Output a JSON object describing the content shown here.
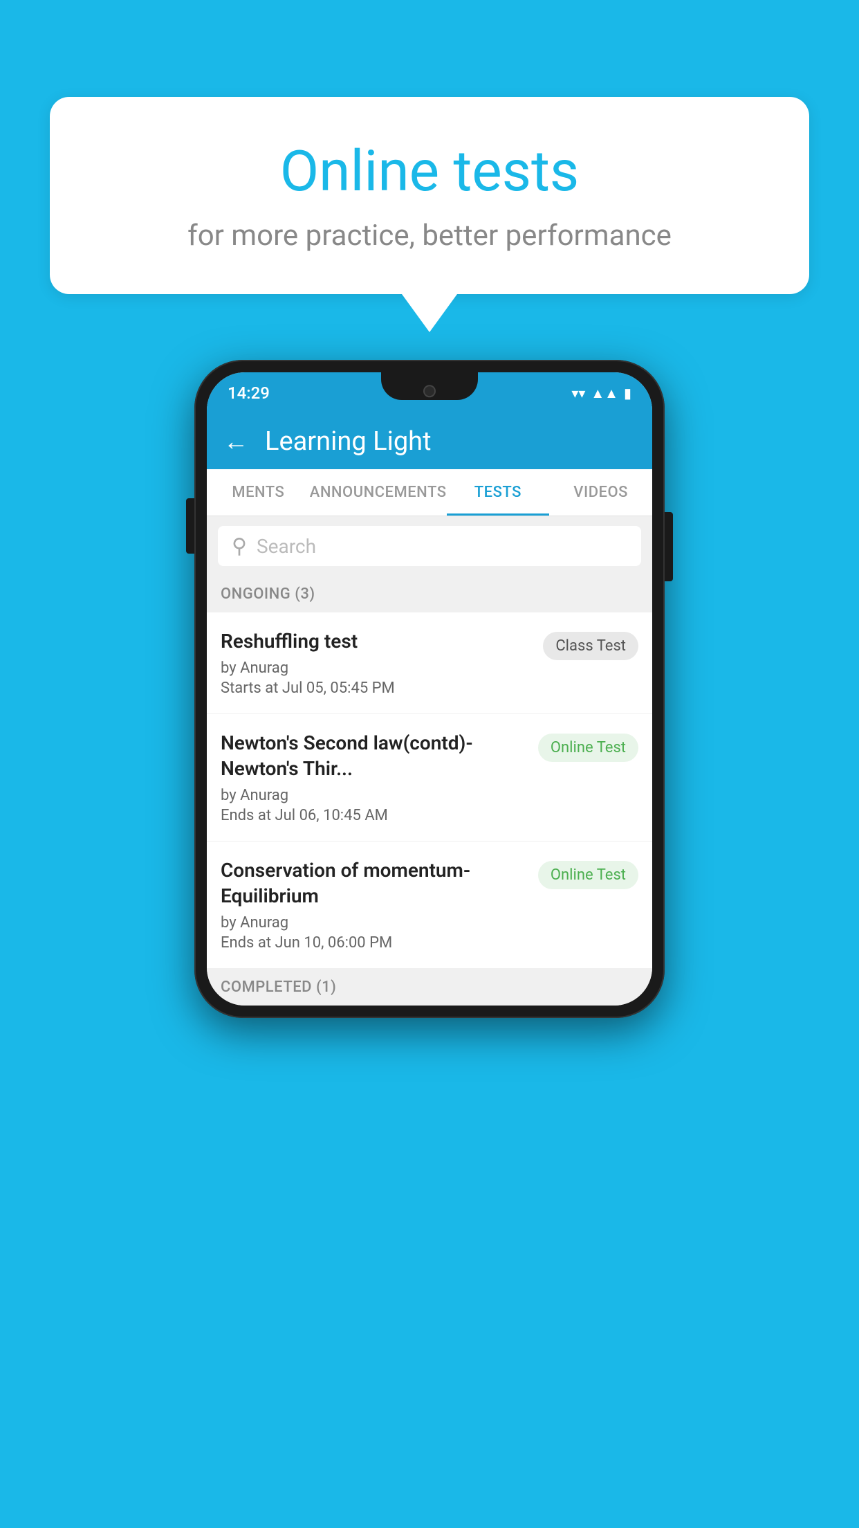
{
  "background": {
    "color": "#1ab8e8"
  },
  "speech_bubble": {
    "title": "Online tests",
    "subtitle": "for more practice, better performance"
  },
  "phone": {
    "status_bar": {
      "time": "14:29",
      "icons": [
        "wifi",
        "signal",
        "battery"
      ]
    },
    "app_bar": {
      "back_label": "←",
      "title": "Learning Light"
    },
    "tabs": [
      {
        "label": "MENTS",
        "active": false
      },
      {
        "label": "ANNOUNCEMENTS",
        "active": false
      },
      {
        "label": "TESTS",
        "active": true
      },
      {
        "label": "VIDEOS",
        "active": false
      }
    ],
    "search": {
      "placeholder": "Search"
    },
    "sections": [
      {
        "header": "ONGOING (3)",
        "tests": [
          {
            "title": "Reshuffling test",
            "author": "by Anurag",
            "date": "Starts at  Jul 05, 05:45 PM",
            "badge": "Class Test",
            "badge_type": "class"
          },
          {
            "title": "Newton's Second law(contd)-Newton's Thir...",
            "author": "by Anurag",
            "date": "Ends at  Jul 06, 10:45 AM",
            "badge": "Online Test",
            "badge_type": "online"
          },
          {
            "title": "Conservation of momentum-Equilibrium",
            "author": "by Anurag",
            "date": "Ends at  Jun 10, 06:00 PM",
            "badge": "Online Test",
            "badge_type": "online"
          }
        ]
      },
      {
        "header": "COMPLETED (1)",
        "tests": []
      }
    ]
  }
}
